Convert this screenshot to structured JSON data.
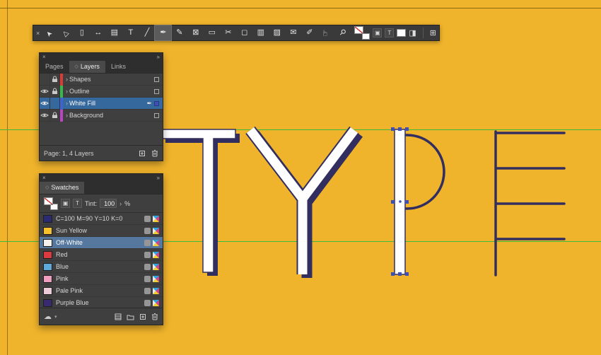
{
  "canvas": {
    "word": "TYPE",
    "background": "#F0B42C",
    "guide_color": "#3DBA3D",
    "letter_outline_color": "#322E5F",
    "selection_handle_color": "#3F4FB4"
  },
  "toolbar": {
    "close_glyph": "×",
    "tools": [
      {
        "name": "selection-tool",
        "glyph": "➤"
      },
      {
        "name": "direct-selection-tool",
        "glyph": "▷"
      },
      {
        "name": "page-tool",
        "glyph": "▯"
      },
      {
        "name": "gap-tool",
        "glyph": "↔"
      },
      {
        "name": "content-collector-tool",
        "glyph": "▤"
      },
      {
        "name": "type-tool",
        "glyph": "T"
      },
      {
        "name": "line-tool",
        "glyph": "╱"
      },
      {
        "name": "pen-tool",
        "glyph": "✒",
        "active": true
      },
      {
        "name": "pencil-tool",
        "glyph": "✎"
      },
      {
        "name": "rectangle-frame-tool",
        "glyph": "⊠"
      },
      {
        "name": "rectangle-tool",
        "glyph": "▭"
      },
      {
        "name": "scissors-tool",
        "glyph": "✂"
      },
      {
        "name": "free-transform-tool",
        "glyph": "◻"
      },
      {
        "name": "gradient-swatch-tool",
        "glyph": "▥"
      },
      {
        "name": "gradient-feather-tool",
        "glyph": "▨"
      },
      {
        "name": "note-tool",
        "glyph": "✉"
      },
      {
        "name": "eyedropper-tool",
        "glyph": "✐"
      },
      {
        "name": "hand-tool",
        "glyph": "☞"
      },
      {
        "name": "zoom-tool",
        "glyph": "⚲"
      }
    ],
    "formatting_container": "▣",
    "formatting_text": "T",
    "screen_mode": "◨",
    "panel_end": "⊞"
  },
  "layers_panel": {
    "close_glyph": "×",
    "collapse_glyph": "»",
    "tab_icon": "◇",
    "tabs": [
      "Pages",
      "Layers",
      "Links"
    ],
    "active_tab": "Layers",
    "expander_glyph": "›",
    "rows": [
      {
        "name": "Shapes",
        "color": "#DE3A35",
        "visible": false,
        "locked": true,
        "selected": false
      },
      {
        "name": "Outline",
        "color": "#35B948",
        "visible": true,
        "locked": true,
        "selected": false
      },
      {
        "name": "White Fill",
        "color": "#3F63D2",
        "visible": true,
        "locked": false,
        "selected": true
      },
      {
        "name": "Background",
        "color": "#BC43C4",
        "visible": true,
        "locked": true,
        "selected": false
      }
    ],
    "footer": "Page: 1, 4 Layers"
  },
  "swatches_panel": {
    "close_glyph": "×",
    "collapse_glyph": "»",
    "tab_icon": "◇",
    "tab": "Swatches",
    "tint_label": "Tint:",
    "tint_value": "100",
    "tint_arrow": "›",
    "tint_unit": "%",
    "cloud_glyph": "☁",
    "rows": [
      {
        "name": "C=100 M=90 Y=10 K=0",
        "color": "#2B2B72",
        "selected": false
      },
      {
        "name": "Sun Yellow",
        "color": "#F5C02C",
        "selected": false
      },
      {
        "name": "Off-White",
        "color": "#F4F2EB",
        "selected": true
      },
      {
        "name": "Red",
        "color": "#D93B40",
        "selected": false
      },
      {
        "name": "Blue",
        "color": "#5FA8DC",
        "selected": false
      },
      {
        "name": "Pink",
        "color": "#F09EC0",
        "selected": false
      },
      {
        "name": "Pale Pink",
        "color": "#EBCBD8",
        "selected": false
      },
      {
        "name": "Purple Blue",
        "color": "#372A6E",
        "selected": false
      }
    ]
  }
}
